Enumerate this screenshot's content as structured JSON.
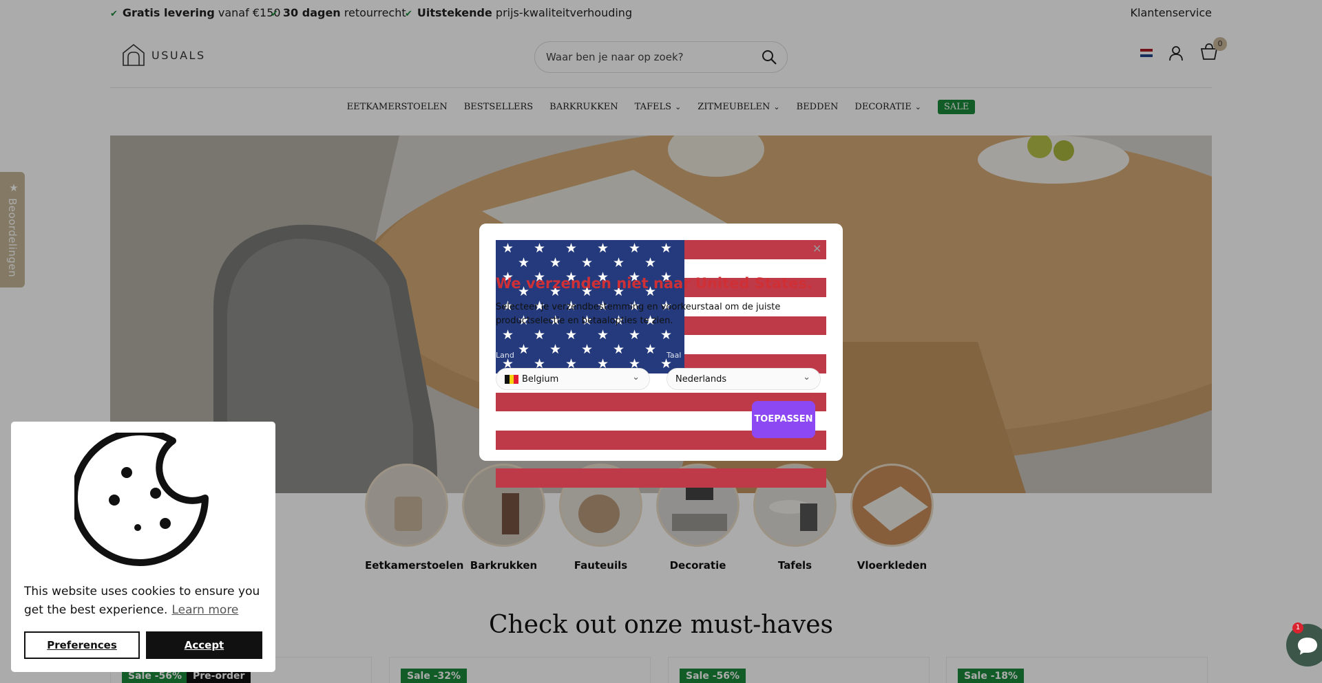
{
  "usp": [
    {
      "bold": "Gratis levering",
      "text": "vanaf €150"
    },
    {
      "bold": "30 dagen",
      "text": "retourrecht"
    },
    {
      "bold": "Uitstekende",
      "text": "prijs-kwaliteitverhouding"
    }
  ],
  "header": {
    "customer_service": "Klantenservice",
    "logo_text": "USUALS",
    "search_placeholder": "Waar ben je naar op zoek?",
    "cart_count": "0"
  },
  "nav": [
    {
      "label": "EETKAMERSTOELEN",
      "chevron": false
    },
    {
      "label": "BESTSELLERS",
      "chevron": false
    },
    {
      "label": "BARKRUKKEN",
      "chevron": false
    },
    {
      "label": "TAFELS",
      "chevron": true
    },
    {
      "label": "ZITMEUBELEN",
      "chevron": true
    },
    {
      "label": "BEDDEN",
      "chevron": false
    },
    {
      "label": "DECORATIE",
      "chevron": true
    },
    {
      "label": "SALE",
      "chevron": false,
      "highlight": true
    }
  ],
  "reviews_tab": "Beoordelingen",
  "categories": [
    "Eetkamerstoelen",
    "Barkrukken",
    "Fauteuils",
    "Decoratie",
    "Tafels",
    "Vloerkleden"
  ],
  "section_title": "Check out onze must-haves",
  "products": [
    {
      "badges": [
        "Sale -56%",
        "Pre-order"
      ]
    },
    {
      "badges": [
        "Sale -32%"
      ]
    },
    {
      "badges": [
        "Sale -56%"
      ]
    },
    {
      "badges": [
        "Sale -18%"
      ]
    }
  ],
  "modal": {
    "title": "We verzenden niet naar United States.",
    "text": "Selecteer je verzendbestemming en voorkeurstaal om de juiste productselectie en betaalopties te zien.",
    "country_label": "Land",
    "language_label": "Taal",
    "country": "Belgium",
    "language": "Nederlands",
    "apply": "TOEPASSEN"
  },
  "cookie": {
    "message": "This website uses cookies to ensure you get the best experience.",
    "learn_more": "Learn more",
    "preferences": "Preferences",
    "accept": "Accept"
  },
  "chat_badge": "1",
  "colors": {
    "sale_green": "#1c8a3c",
    "apply_purple": "#8b48f3",
    "modal_title_red": "#cf3036"
  },
  "icons": [
    "check-icon",
    "search-icon",
    "nl-flag-icon",
    "user-icon",
    "cart-icon",
    "star-icon",
    "close-icon",
    "be-flag-icon",
    "cookie-icon",
    "chat-icon"
  ]
}
